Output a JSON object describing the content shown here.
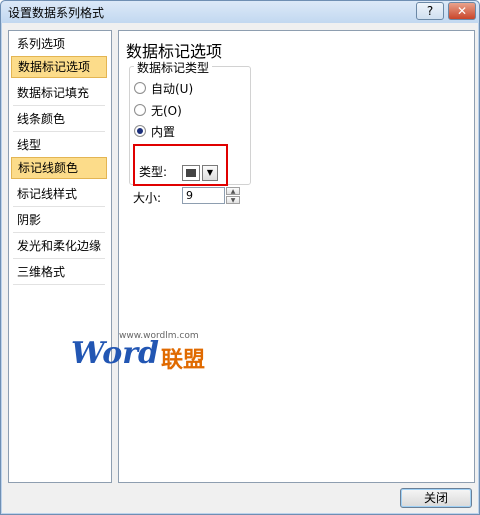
{
  "window": {
    "title": "设置数据系列格式",
    "help_label": "?",
    "close_label": "✕"
  },
  "sidebar": {
    "items": [
      {
        "label": "系列选项",
        "selected": false
      },
      {
        "label": "数据标记选项",
        "selected": true
      },
      {
        "label": "数据标记填充",
        "selected": false
      },
      {
        "label": "线条颜色",
        "selected": false
      },
      {
        "label": "线型",
        "selected": false
      },
      {
        "label": "标记线颜色",
        "selected": true
      },
      {
        "label": "标记线样式",
        "selected": false
      },
      {
        "label": "阴影",
        "selected": false
      },
      {
        "label": "发光和柔化边缘",
        "selected": false
      },
      {
        "label": "三维格式",
        "selected": false
      }
    ]
  },
  "panel": {
    "heading": "数据标记选项",
    "group_title": "数据标记类型",
    "options": [
      {
        "label": "自动(U)",
        "checked": false
      },
      {
        "label": "无(O)",
        "checked": false
      },
      {
        "label": "内置",
        "checked": true
      }
    ],
    "type_label": "类型:",
    "type_icon": "filled-square-marker",
    "size_label": "大小:",
    "size_value": "9"
  },
  "watermark": {
    "url": "www.wordlm.com",
    "word": "Word",
    "cn": "联盟"
  },
  "footer": {
    "close_label": "关闭"
  },
  "colors": {
    "selection": "#fcdc8a",
    "highlight_box": "#e00000",
    "close_button": "#c9452a"
  }
}
